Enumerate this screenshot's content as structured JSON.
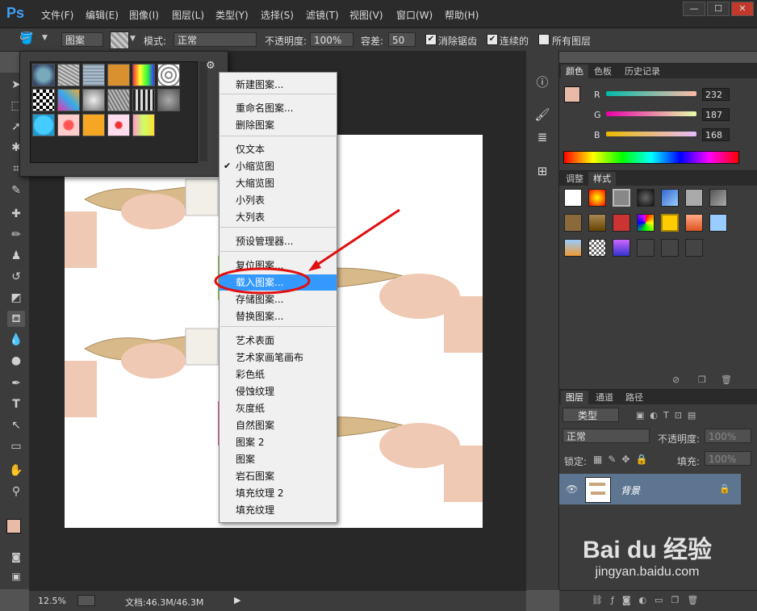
{
  "app": {
    "logo": "Ps"
  },
  "menubar": {
    "items": [
      "文件(F)",
      "编辑(E)",
      "图像(I)",
      "图层(L)",
      "类型(Y)",
      "选择(S)",
      "滤镜(T)",
      "视图(V)",
      "窗口(W)",
      "帮助(H)"
    ],
    "window_buttons": [
      "—",
      "☐",
      "✕"
    ]
  },
  "options": {
    "fill_source": "图案",
    "mode_label": "模式:",
    "mode_value": "正常",
    "opacity_label": "不透明度:",
    "opacity_value": "100%",
    "tolerance_label": "容差:",
    "tolerance_value": "50",
    "antialias_label": "消除锯齿",
    "contiguous_label": "连续的",
    "all_layers_label": "所有图层"
  },
  "pattern_menu": {
    "items": [
      {
        "label": "新建图案...",
        "highlight": false
      },
      {
        "label": "重命名图案...",
        "highlight": false
      },
      {
        "label": "删除图案",
        "highlight": false
      },
      {
        "label": "仅文本",
        "highlight": false
      },
      {
        "label": "小缩览图",
        "highlight": false,
        "checked": true
      },
      {
        "label": "大缩览图",
        "highlight": false
      },
      {
        "label": "小列表",
        "highlight": false
      },
      {
        "label": "大列表",
        "highlight": false
      },
      {
        "label": "预设管理器...",
        "highlight": false
      },
      {
        "label": "复位图案...",
        "highlight": false
      },
      {
        "label": "载入图案...",
        "highlight": true
      },
      {
        "label": "存储图案...",
        "highlight": false
      },
      {
        "label": "替换图案...",
        "highlight": false
      },
      {
        "label": "艺术表面",
        "highlight": false
      },
      {
        "label": "艺术家画笔画布",
        "highlight": false
      },
      {
        "label": "彩色纸",
        "highlight": false
      },
      {
        "label": "侵蚀纹理",
        "highlight": false
      },
      {
        "label": "灰度纸",
        "highlight": false
      },
      {
        "label": "自然图案",
        "highlight": false
      },
      {
        "label": "图案 2",
        "highlight": false
      },
      {
        "label": "图案",
        "highlight": false
      },
      {
        "label": "岩石图案",
        "highlight": false
      },
      {
        "label": "填充纹理 2",
        "highlight": false
      },
      {
        "label": "填充纹理",
        "highlight": false
      }
    ]
  },
  "color_panel": {
    "tabs": [
      "颜色",
      "色板",
      "历史记录"
    ],
    "r_label": "R",
    "g_label": "G",
    "b_label": "B",
    "r": 232,
    "g": 187,
    "b": 168,
    "swatch_color": "#e8bba8"
  },
  "styles_panel": {
    "tabs": [
      "调整",
      "样式"
    ]
  },
  "layers_panel": {
    "tabs": [
      "图层",
      "通道",
      "路径"
    ],
    "filter_label": "类型",
    "blend_mode": "正常",
    "opacity_label": "不透明度:",
    "opacity_value": "100%",
    "lock_label": "锁定:",
    "fill_label": "填充:",
    "fill_value": "100%",
    "layer_name": "背景"
  },
  "status": {
    "zoom": "12.5%",
    "doc_info": "文档:46.3M/46.3M"
  },
  "watermark": {
    "brand": "Bai du 经验",
    "url": "jingyan.baidu.com"
  }
}
